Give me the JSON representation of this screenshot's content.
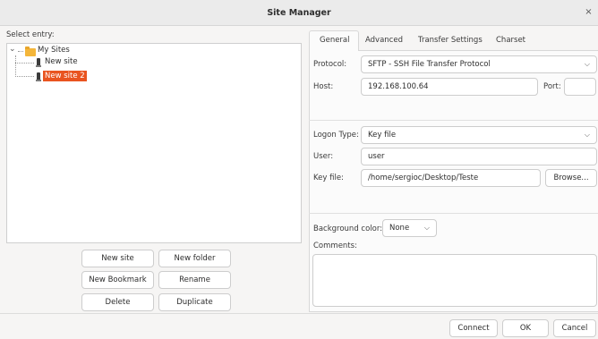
{
  "window": {
    "title": "Site Manager",
    "close_glyph": "×"
  },
  "left": {
    "select_entry_label": "Select entry:",
    "tree": {
      "root": "My Sites",
      "items": [
        "New site",
        "New site 2"
      ],
      "expander": "⌄"
    },
    "buttons": {
      "new_site": "New site",
      "new_folder": "New folder",
      "new_bookmark": "New Bookmark",
      "rename": "Rename",
      "delete": "Delete",
      "duplicate": "Duplicate"
    }
  },
  "tabs": [
    "General",
    "Advanced",
    "Transfer Settings",
    "Charset"
  ],
  "general": {
    "protocol_label": "Protocol:",
    "protocol_value": "SFTP - SSH File Transfer Protocol",
    "host_label": "Host:",
    "host_value": "192.168.100.64",
    "port_label": "Port:",
    "port_value": "",
    "logon_type_label": "Logon Type:",
    "logon_type_value": "Key file",
    "user_label": "User:",
    "user_value": "user",
    "key_file_label": "Key file:",
    "key_file_value": "/home/sergioc/Desktop/Teste",
    "browse_label": "Browse...",
    "bg_color_label": "Background color:",
    "bg_color_value": "None",
    "comments_label": "Comments:",
    "comments_value": ""
  },
  "footer": {
    "connect": "Connect",
    "ok": "OK",
    "cancel": "Cancel"
  },
  "icons": {
    "folder": "folder-icon",
    "site": "site-icon",
    "chevron": "chevron-down-icon",
    "close": "close-icon"
  }
}
